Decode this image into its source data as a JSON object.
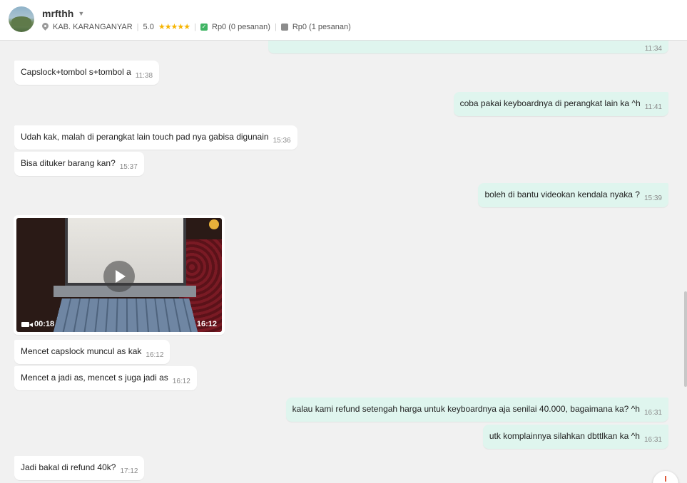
{
  "header": {
    "username": "mrfthh",
    "location": "KAB. KARANGANYAR",
    "rating": "5.0",
    "stars_count": 5,
    "paid_summary": "Rp0 (0 pesanan)",
    "pending_summary": "Rp0 (1 pesanan)"
  },
  "messages": [
    {
      "side": "out",
      "text": "",
      "time": "11:34"
    },
    {
      "side": "in",
      "text": "Capslock+tombol s+tombol a",
      "time": "11:38"
    },
    {
      "side": "out",
      "text": "coba pakai keyboardnya di perangkat lain ka ^h",
      "time": "11:41"
    },
    {
      "side": "in",
      "text": "Udah kak, malah di perangkat lain touch pad nya gabisa digunain",
      "time": "15:36"
    },
    {
      "side": "in",
      "text": "Bisa dituker barang kan?",
      "time": "15:37"
    },
    {
      "side": "out",
      "text": "boleh di bantu videokan kendala nyaka ?",
      "time": "15:39"
    },
    {
      "side": "in",
      "text": "Mencet capslock muncul as kak",
      "time": "16:12"
    },
    {
      "side": "in",
      "text": "Mencet a jadi as, mencet s juga jadi as",
      "time": "16:12"
    },
    {
      "side": "out",
      "text": "kalau kami refund setengah harga untuk keyboardnya aja senilai 40.000, bagaimana ka? ^h",
      "time": "16:31"
    },
    {
      "side": "out",
      "text": "utk komplainnya silahkan dbttlkan ka ^h",
      "time": "16:31"
    },
    {
      "side": "in",
      "text": "Jadi bakal di refund 40k?",
      "time": "17:12"
    }
  ],
  "video": {
    "duration": "00:18",
    "time": "16:12"
  },
  "colors": {
    "outgoing_bubble": "#dff5ee",
    "incoming_bubble": "#ffffff",
    "background": "#f1f1f1",
    "star": "#f6b400"
  }
}
